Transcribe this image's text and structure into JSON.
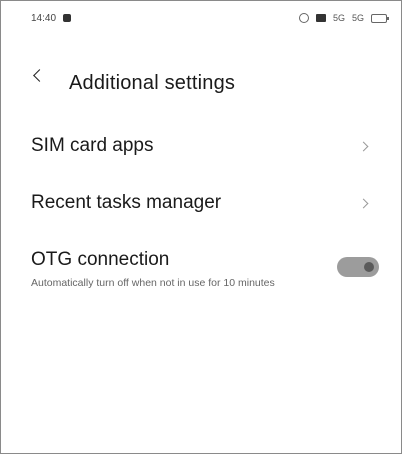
{
  "status_bar": {
    "time": "14:40",
    "network_labels": [
      "5G",
      "5G"
    ]
  },
  "header": {
    "title": "Additional settings"
  },
  "settings": {
    "items": [
      {
        "label": "SIM card apps"
      },
      {
        "label": "Recent tasks manager"
      }
    ],
    "otg": {
      "label": "OTG connection",
      "description": "Automatically turn off when not in use for 10 minutes",
      "enabled": false
    }
  },
  "colors": {
    "toggle_track": "#9c9c9c",
    "toggle_knob": "#5a5a5a",
    "chevron": "#9a9a9a"
  }
}
